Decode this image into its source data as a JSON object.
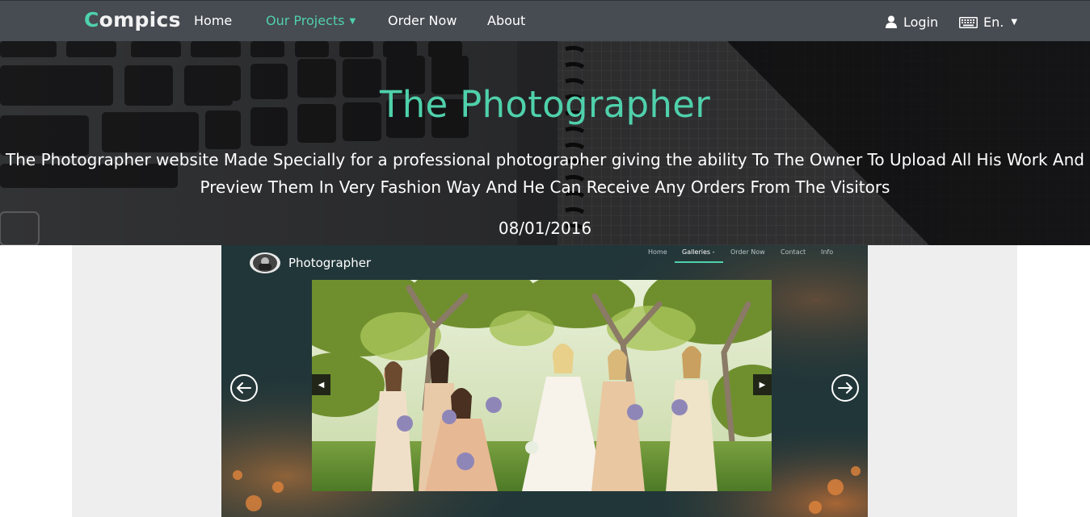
{
  "nav": {
    "brand_first": "C",
    "brand_rest": "ompics",
    "links": [
      {
        "label": "Home"
      },
      {
        "label": "Our Projects"
      },
      {
        "label": "Order Now"
      },
      {
        "label": "About"
      }
    ],
    "login_label": "Login",
    "lang_label": "En.",
    "accent_color": "#4fd1ab",
    "bar_color": "#474b52"
  },
  "hero": {
    "title": "The Photographer",
    "description": "The Photographer website Made Specially for a professional photographer giving the ability To The Owner To Upload All His Work And Preview Them In Very Fashion Way And He Can Receive Any Orders From The Visitors",
    "date": "08/01/2016"
  },
  "preview": {
    "brand": "Photographer",
    "nav": [
      "Home",
      "Galleries -",
      "Order Now",
      "Contact",
      "Info"
    ],
    "active_nav": "Galleries -"
  }
}
